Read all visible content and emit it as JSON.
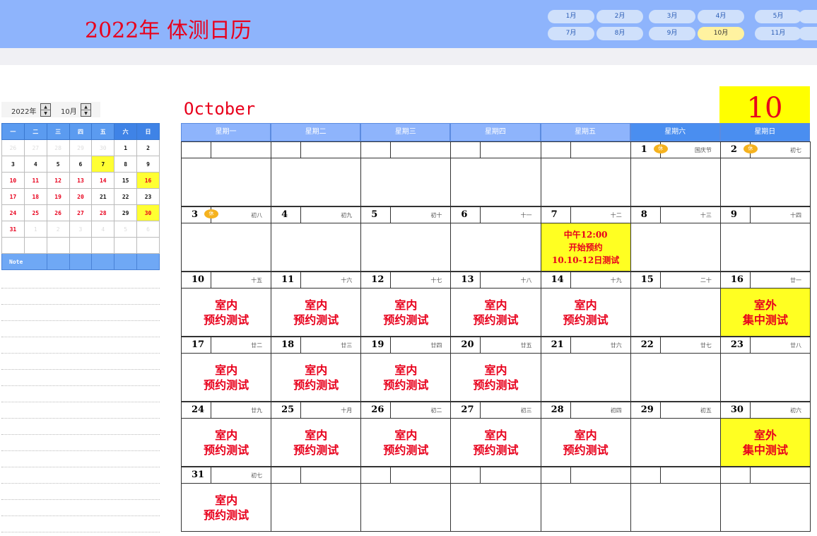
{
  "header": {
    "title": "2022年 体测日历",
    "months_row1": [
      "1月",
      "2月",
      "3月",
      "4月",
      "5月"
    ],
    "months_row2": [
      "7月",
      "8月",
      "9月",
      "10月",
      "11月"
    ],
    "active_month": "10月"
  },
  "picker": {
    "year": "2022年",
    "month": "10月"
  },
  "mini_calendar": {
    "weekdays": [
      "一",
      "二",
      "三",
      "四",
      "五",
      "六",
      "日"
    ],
    "weeks": [
      [
        "26",
        "27",
        "28",
        "29",
        "30",
        "1",
        "2"
      ],
      [
        "3",
        "4",
        "5",
        "6",
        "7",
        "8",
        "9"
      ],
      [
        "10",
        "11",
        "12",
        "13",
        "14",
        "15",
        "16"
      ],
      [
        "17",
        "18",
        "19",
        "20",
        "21",
        "22",
        "23"
      ],
      [
        "24",
        "25",
        "26",
        "27",
        "28",
        "29",
        "30"
      ],
      [
        "31",
        "1",
        "2",
        "3",
        "4",
        "5",
        "6"
      ],
      [
        "",
        "",
        "",
        "",
        "",
        "",
        ""
      ]
    ],
    "note_label": "Note"
  },
  "calendar": {
    "month_name": "October",
    "month_number": "10",
    "weekdays": [
      "星期一",
      "星期二",
      "星期三",
      "星期四",
      "星期五",
      "星期六",
      "星期日"
    ],
    "rest_label": "休",
    "weeks": [
      [
        {
          "day": "",
          "lunar": "",
          "event": ""
        },
        {
          "day": "",
          "lunar": "",
          "event": ""
        },
        {
          "day": "",
          "lunar": "",
          "event": ""
        },
        {
          "day": "",
          "lunar": "",
          "event": ""
        },
        {
          "day": "",
          "lunar": "",
          "event": ""
        },
        {
          "day": "1",
          "lunar": "国庆节",
          "event": "",
          "rest": true
        },
        {
          "day": "2",
          "lunar": "初七",
          "event": "",
          "rest": true
        }
      ],
      [
        {
          "day": "3",
          "lunar": "初八",
          "event": "",
          "rest": true
        },
        {
          "day": "4",
          "lunar": "初九",
          "event": ""
        },
        {
          "day": "5",
          "lunar": "初十",
          "event": ""
        },
        {
          "day": "6",
          "lunar": "十一",
          "event": ""
        },
        {
          "day": "7",
          "lunar": "十二",
          "event": "中午12:00\n开始预约\n10.10-12日测试",
          "highlight": true,
          "small": true
        },
        {
          "day": "8",
          "lunar": "十三",
          "event": ""
        },
        {
          "day": "9",
          "lunar": "十四",
          "event": ""
        }
      ],
      [
        {
          "day": "10",
          "lunar": "十五",
          "event": "室内\n预约测试"
        },
        {
          "day": "11",
          "lunar": "十六",
          "event": "室内\n预约测试"
        },
        {
          "day": "12",
          "lunar": "十七",
          "event": "室内\n预约测试"
        },
        {
          "day": "13",
          "lunar": "十八",
          "event": "室内\n预约测试"
        },
        {
          "day": "14",
          "lunar": "十九",
          "event": "室内\n预约测试"
        },
        {
          "day": "15",
          "lunar": "二十",
          "event": ""
        },
        {
          "day": "16",
          "lunar": "廿一",
          "event": "室外\n集中测试",
          "highlight": true
        }
      ],
      [
        {
          "day": "17",
          "lunar": "廿二",
          "event": "室内\n预约测试"
        },
        {
          "day": "18",
          "lunar": "廿三",
          "event": "室内\n预约测试"
        },
        {
          "day": "19",
          "lunar": "廿四",
          "event": "室内\n预约测试"
        },
        {
          "day": "20",
          "lunar": "廿五",
          "event": "室内\n预约测试"
        },
        {
          "day": "21",
          "lunar": "廿六",
          "event": ""
        },
        {
          "day": "22",
          "lunar": "廿七",
          "event": ""
        },
        {
          "day": "23",
          "lunar": "廿八",
          "event": ""
        }
      ],
      [
        {
          "day": "24",
          "lunar": "廿九",
          "event": "室内\n预约测试"
        },
        {
          "day": "25",
          "lunar": "十月",
          "event": "室内\n预约测试"
        },
        {
          "day": "26",
          "lunar": "初二",
          "event": "室内\n预约测试"
        },
        {
          "day": "27",
          "lunar": "初三",
          "event": "室内\n预约测试"
        },
        {
          "day": "28",
          "lunar": "初四",
          "event": "室内\n预约测试"
        },
        {
          "day": "29",
          "lunar": "初五",
          "event": ""
        },
        {
          "day": "30",
          "lunar": "初六",
          "event": "室外\n集中测试",
          "highlight": true
        }
      ],
      [
        {
          "day": "31",
          "lunar": "初七",
          "event": "室内\n预约测试"
        },
        {
          "day": "",
          "lunar": "",
          "event": ""
        },
        {
          "day": "",
          "lunar": "",
          "event": ""
        },
        {
          "day": "",
          "lunar": "",
          "event": ""
        },
        {
          "day": "",
          "lunar": "",
          "event": ""
        },
        {
          "day": "",
          "lunar": "",
          "event": ""
        },
        {
          "day": "",
          "lunar": "",
          "event": ""
        }
      ]
    ]
  }
}
